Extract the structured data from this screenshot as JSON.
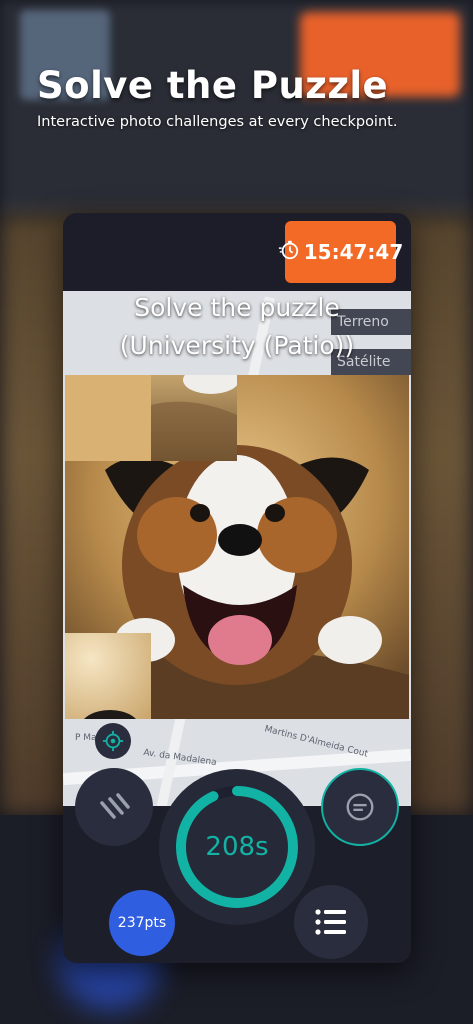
{
  "header": {
    "title": "Solve the Puzzle",
    "subtitle": "Interactive photo challenges at every checkpoint."
  },
  "timer": {
    "value": "15:47:47",
    "icon": "stopwatch-icon"
  },
  "puzzle": {
    "title": "Solve the puzzle",
    "location": "(University (Patio))"
  },
  "map": {
    "type_options": [
      "Terreno",
      "Satélite"
    ],
    "labels": [
      "Av. da Madalena",
      "Martins D'Almeida Cout",
      "P Mad"
    ]
  },
  "countdown": {
    "label": "208s",
    "progress": 0.93
  },
  "points": {
    "label": "237pts"
  },
  "colors": {
    "accent": "#f36a26",
    "ring": "#12b3a4",
    "points": "#2f5ee0",
    "panel": "#1c1d28"
  }
}
